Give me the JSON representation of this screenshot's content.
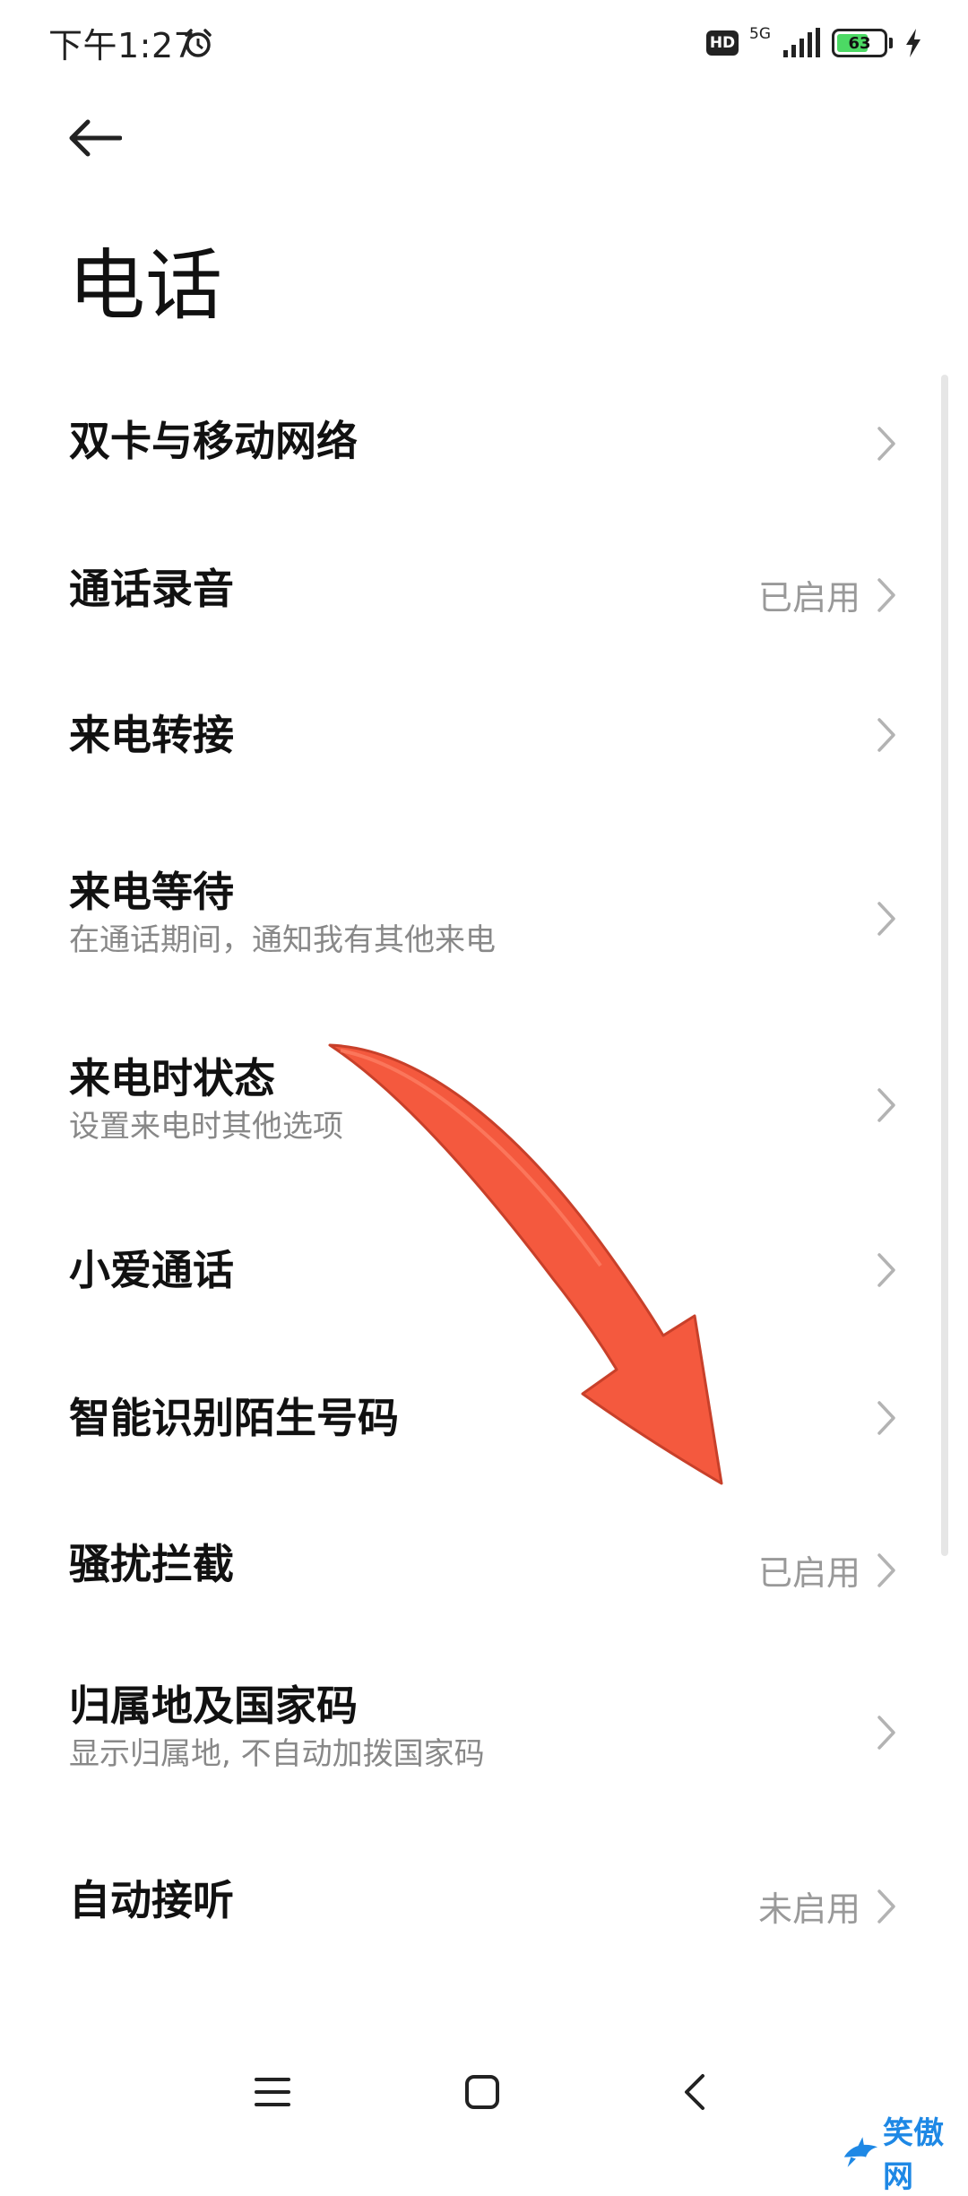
{
  "status_bar": {
    "time": "下午1:27",
    "hd": "HD",
    "network": "5G",
    "battery": "63"
  },
  "header": {
    "title": "电话"
  },
  "rows": [
    {
      "title": "双卡与移动网络",
      "subtitle": "",
      "value": ""
    },
    {
      "title": "通话录音",
      "subtitle": "",
      "value": "已启用"
    },
    {
      "title": "来电转接",
      "subtitle": "",
      "value": ""
    },
    {
      "title": "来电等待",
      "subtitle": "在通话期间，通知我有其他来电",
      "value": ""
    },
    {
      "title": "来电时状态",
      "subtitle": "设置来电时其他选项",
      "value": ""
    },
    {
      "title": "小爱通话",
      "subtitle": "",
      "value": ""
    },
    {
      "title": "智能识别陌生号码",
      "subtitle": "",
      "value": ""
    },
    {
      "title": "骚扰拦截",
      "subtitle": "",
      "value": "已启用"
    },
    {
      "title": "归属地及国家码",
      "subtitle": "显示归属地, 不自动加拨国家码",
      "value": ""
    },
    {
      "title": "自动接听",
      "subtitle": "",
      "value": "未启用"
    }
  ],
  "watermark": {
    "text": "笑傲网"
  },
  "colors": {
    "arrow": "#f4593e",
    "battery": "#4cd964",
    "value_text": "#999999"
  }
}
